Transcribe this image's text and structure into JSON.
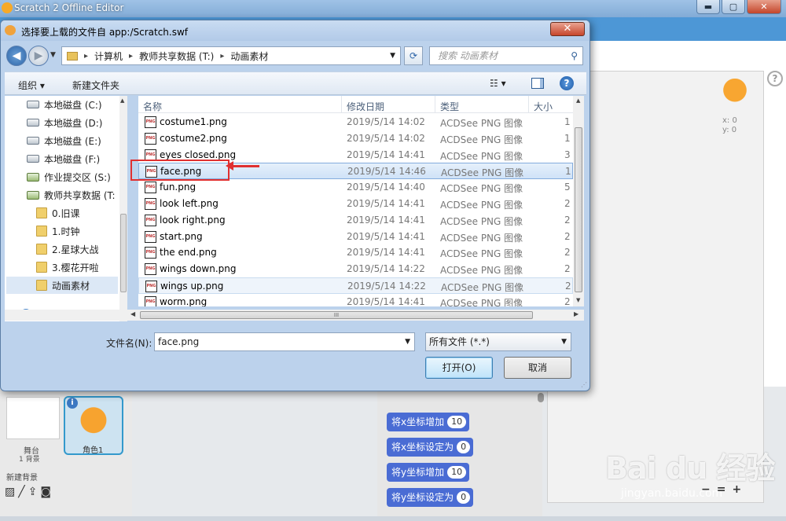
{
  "bg": {
    "app_title": "Scratch 2 Offline Editor",
    "win_min": "▬",
    "win_max": "▢",
    "win_close": "✕",
    "help": "?",
    "x_coord": "x: 0",
    "y_coord": "y: 0",
    "stage_label": "舞台",
    "stage_bg_count": "1 背景",
    "new_backdrop": "新建背景",
    "sprite_label": "角色1",
    "info": "i",
    "blocks": [
      {
        "label": "将x坐标增加",
        "value": "10"
      },
      {
        "label": "将x坐标设定为",
        "value": "0"
      },
      {
        "label": "将y坐标增加",
        "value": "10"
      },
      {
        "label": "将y坐标设定为",
        "value": "0"
      }
    ],
    "zoom_out": "−",
    "zoom_reset": "=",
    "zoom_in": "+",
    "watermark": "Bai du 经验",
    "watermark_url": "jingyan.baidu.com"
  },
  "dialog": {
    "title": "选择要上载的文件自 app:/Scratch.swf",
    "close": "✕",
    "path": [
      "计算机",
      "教师共享数据 (T:)",
      "动画素材"
    ],
    "search_placeholder": "搜索 动画素材",
    "organize": "组织 ▾",
    "new_folder": "新建文件夹",
    "views_icon": "☷ ▾",
    "help_icon": "?",
    "nav": [
      {
        "label": "本地磁盘 (C:)",
        "kind": "drive"
      },
      {
        "label": "本地磁盘 (D:)",
        "kind": "drive"
      },
      {
        "label": "本地磁盘 (E:)",
        "kind": "drive"
      },
      {
        "label": "本地磁盘 (F:)",
        "kind": "drive"
      },
      {
        "label": "作业提交区 (S:)",
        "kind": "net"
      },
      {
        "label": "教师共享数据 (T:",
        "kind": "net"
      },
      {
        "label": "0.旧课",
        "kind": "folder"
      },
      {
        "label": "1.时钟",
        "kind": "folder"
      },
      {
        "label": "2.星球大战",
        "kind": "folder"
      },
      {
        "label": "3.樱花开啦",
        "kind": "folder"
      },
      {
        "label": "动画素材",
        "kind": "folder"
      },
      {
        "label": "网络",
        "kind": "globe"
      }
    ],
    "columns": {
      "name": "名称",
      "date": "修改日期",
      "type": "类型",
      "size": "大小"
    },
    "files": [
      {
        "name": "costume1.png",
        "date": "2019/5/14 14:02",
        "type": "ACDSee PNG 图像",
        "size": "1"
      },
      {
        "name": "costume2.png",
        "date": "2019/5/14 14:02",
        "type": "ACDSee PNG 图像",
        "size": "1"
      },
      {
        "name": "eyes closed.png",
        "date": "2019/5/14 14:41",
        "type": "ACDSee PNG 图像",
        "size": "3"
      },
      {
        "name": "face.png",
        "date": "2019/5/14 14:46",
        "type": "ACDSee PNG 图像",
        "size": "1"
      },
      {
        "name": "fun.png",
        "date": "2019/5/14 14:40",
        "type": "ACDSee PNG 图像",
        "size": "5"
      },
      {
        "name": "look left.png",
        "date": "2019/5/14 14:41",
        "type": "ACDSee PNG 图像",
        "size": "2"
      },
      {
        "name": "look right.png",
        "date": "2019/5/14 14:41",
        "type": "ACDSee PNG 图像",
        "size": "2"
      },
      {
        "name": "start.png",
        "date": "2019/5/14 14:41",
        "type": "ACDSee PNG 图像",
        "size": "2"
      },
      {
        "name": "the end.png",
        "date": "2019/5/14 14:41",
        "type": "ACDSee PNG 图像",
        "size": "2"
      },
      {
        "name": "wings down.png",
        "date": "2019/5/14 14:22",
        "type": "ACDSee PNG 图像",
        "size": "2"
      },
      {
        "name": "wings up.png",
        "date": "2019/5/14 14:22",
        "type": "ACDSee PNG 图像",
        "size": "2"
      },
      {
        "name": "worm.png",
        "date": "2019/5/14 14:41",
        "type": "ACDSee PNG 图像",
        "size": "2"
      }
    ],
    "png_badge": "PNG",
    "filename_label": "文件名(N):",
    "filename_value": "face.png",
    "filetype_value": "所有文件 (*.*)",
    "open_button": "打开(O)",
    "cancel_button": "取消"
  }
}
